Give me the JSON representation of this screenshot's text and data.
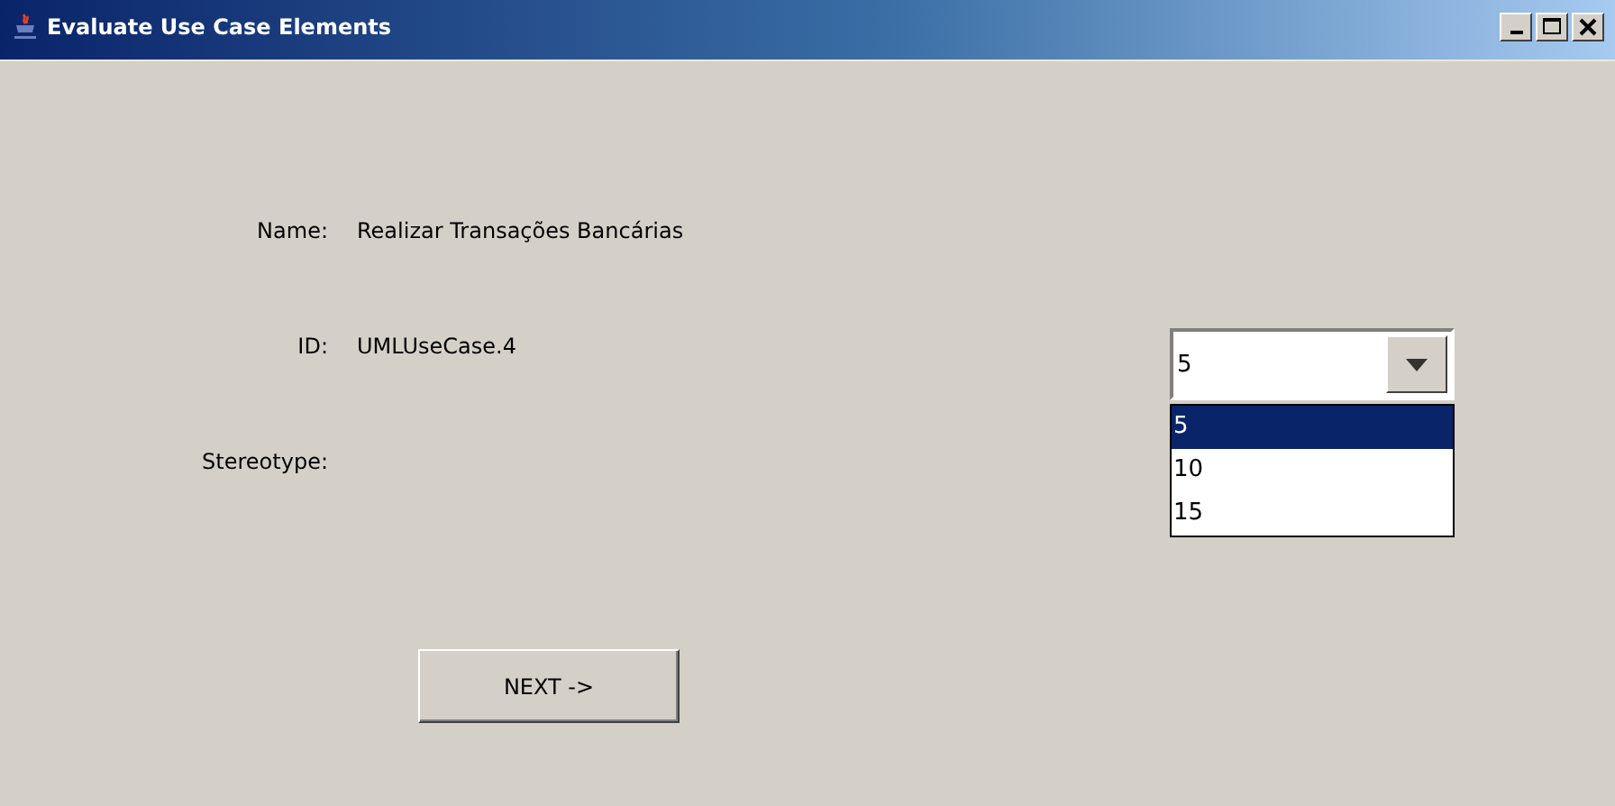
{
  "window": {
    "title": "Evaluate Use Case Elements"
  },
  "fields": [
    {
      "label": "Name:",
      "value": "Realizar Transações Bancárias"
    },
    {
      "label": "ID:",
      "value": "UMLUseCase.4"
    },
    {
      "label": "Stereotype:"
    }
  ],
  "combo": {
    "value": "5",
    "options": [
      {
        "label": "5",
        "selected": true
      },
      {
        "label": "10",
        "selected": false
      },
      {
        "label": "15",
        "selected": false
      }
    ]
  },
  "buttons": [
    "NEXT ->"
  ]
}
